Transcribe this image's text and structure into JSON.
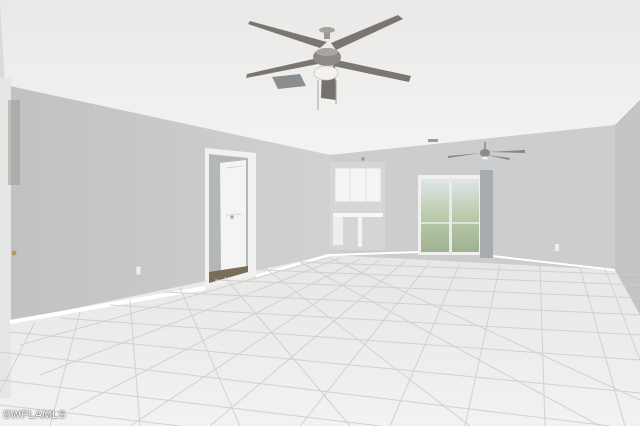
{
  "photo": {
    "subject": "empty-living-room",
    "watermark": "SWFLAMLS"
  },
  "colors": {
    "ceiling": "#f3f2f0",
    "wall": "#c9cbcd",
    "floor": "#e9e9e7",
    "grout": "#c9cbc9",
    "baseboard": "#ffffff",
    "fan_blade": "#7b7672",
    "window_glass": "#b9c7cf"
  }
}
